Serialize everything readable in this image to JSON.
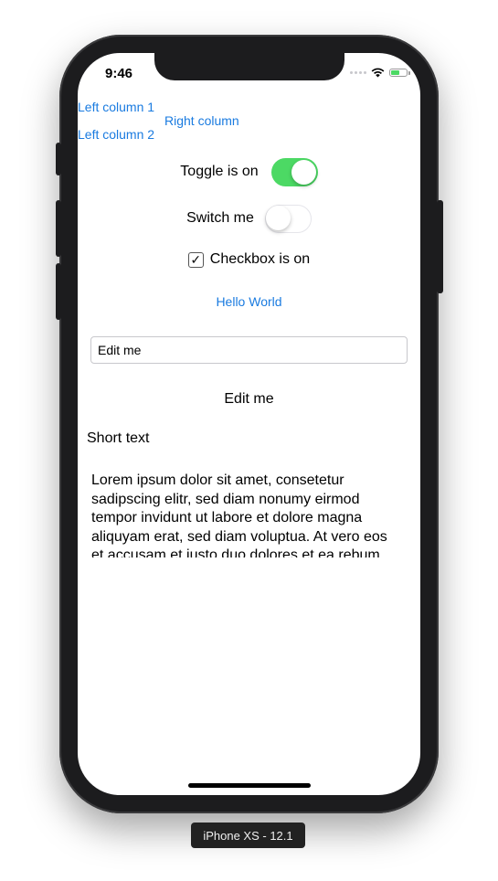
{
  "status_bar": {
    "time": "9:46"
  },
  "columns": {
    "left_1": "Left column 1",
    "left_2": "Left column 2",
    "right": "Right column"
  },
  "toggle_row": {
    "label": "Toggle is on",
    "is_on": true
  },
  "switch_row": {
    "label": "Switch me",
    "is_on": false
  },
  "checkbox_row": {
    "label": "Checkbox is on",
    "checked": true,
    "mark": "✓"
  },
  "hello_button": {
    "label": "Hello World"
  },
  "text_field": {
    "value": "Edit me"
  },
  "mirror_label": {
    "text": "Edit me"
  },
  "short_text": {
    "text": "Short text"
  },
  "lorem": {
    "text": "Lorem ipsum dolor sit amet, consetetur sadipscing elitr, sed diam nonumy eirmod tempor invidunt ut labore et dolore magna aliquyam erat, sed diam voluptua. At vero eos et accusam et justo duo dolores et ea rebum."
  },
  "simulator": {
    "device_label": "iPhone XS - 12.1"
  },
  "colors": {
    "accent": "#1a7be0",
    "toggle_on": "#4cd964",
    "device": "#1c1c1e"
  },
  "icons": {
    "wifi": "wifi-icon",
    "battery": "battery-icon",
    "signal": "signal-dots-icon",
    "check": "checkmark-icon"
  }
}
